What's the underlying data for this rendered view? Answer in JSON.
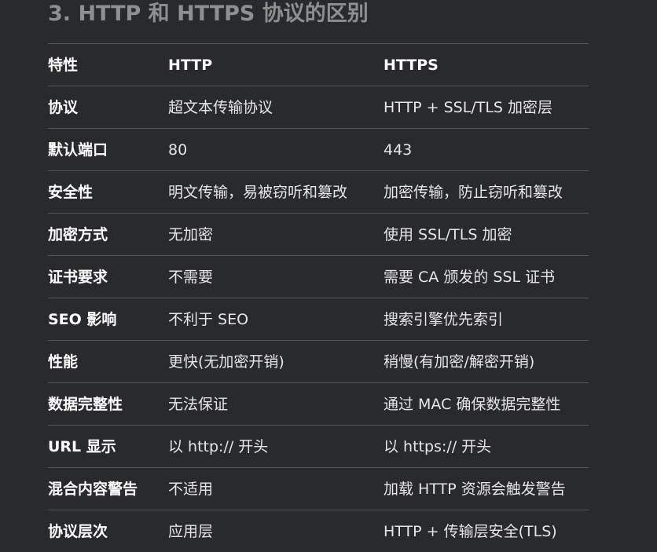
{
  "heading": "3. HTTP 和 HTTPS 协议的区别",
  "table": {
    "headers": [
      "特性",
      "HTTP",
      "HTTPS"
    ],
    "rows": [
      [
        "协议",
        "超文本传输协议",
        "HTTP + SSL/TLS 加密层"
      ],
      [
        "默认端口",
        "80",
        "443"
      ],
      [
        "安全性",
        "明文传输，易被窃听和篡改",
        "加密传输，防止窃听和篡改"
      ],
      [
        "加密方式",
        "无加密",
        "使用 SSL/TLS 加密"
      ],
      [
        "证书要求",
        "不需要",
        "需要 CA 颁发的 SSL 证书"
      ],
      [
        "SEO 影响",
        "不利于 SEO",
        "搜索引擎优先索引"
      ],
      [
        "性能",
        "更快(无加密开销)",
        "稍慢(有加密/解密开销)"
      ],
      [
        "数据完整性",
        "无法保证",
        "通过 MAC 确保数据完整性"
      ],
      [
        "URL 显示",
        "以 http:// 开头",
        "以 https:// 开头"
      ],
      [
        "混合内容警告",
        "不适用",
        "加载 HTTP 资源会触发警告"
      ],
      [
        "协议层次",
        "应用层",
        "HTTP + 传输层安全(TLS)"
      ]
    ]
  }
}
